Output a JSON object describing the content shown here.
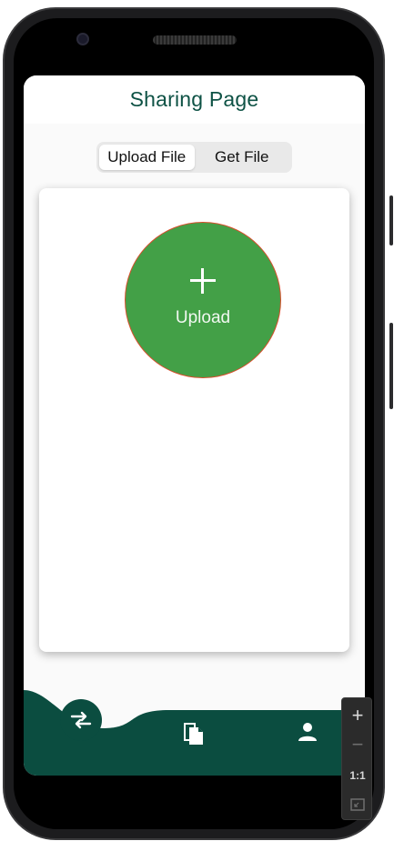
{
  "header": {
    "title": "Sharing Page"
  },
  "segments": {
    "upload_label": "Upload File",
    "get_label": "Get File",
    "active": "upload"
  },
  "upload": {
    "label": "Upload",
    "icon": "plus-icon",
    "color": "#43a047"
  },
  "bottom_nav": {
    "items": [
      {
        "name": "swap",
        "icon": "swap-arrows-icon",
        "active": true
      },
      {
        "name": "files",
        "icon": "files-icon",
        "active": false
      },
      {
        "name": "profile",
        "icon": "person-icon",
        "active": false
      }
    ],
    "color": "#0b4d40"
  },
  "emulator_zoom": {
    "zoom_in": "+",
    "zoom_out": "−",
    "one_to_one": "1:1",
    "fit_icon": "fit-screen-icon"
  },
  "colors": {
    "brand": "#0e5245",
    "accent_green": "#43a047",
    "circle_border": "#d84e2c"
  }
}
